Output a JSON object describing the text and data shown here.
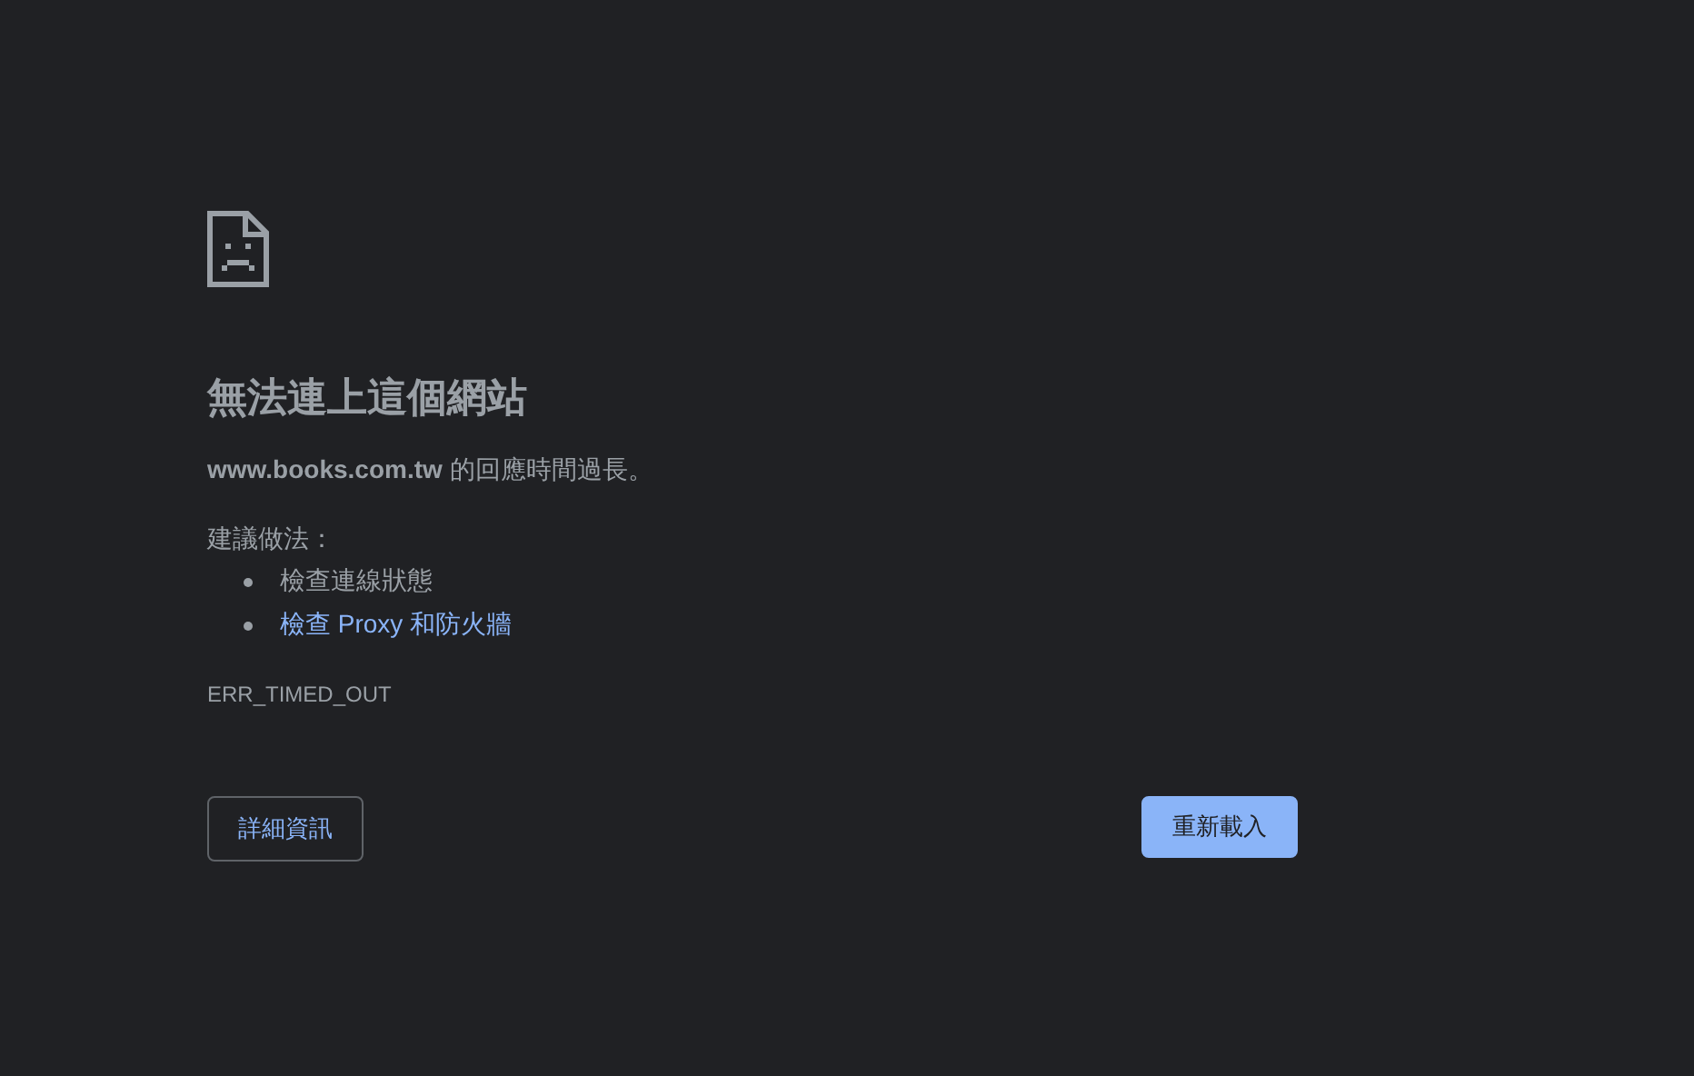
{
  "heading": "無法連上這個網站",
  "summary": "**www.books.com.tw** 的回應時間過長。",
  "suggestions_label": "建議做法：",
  "suggestions": [
    {
      "kind": "text",
      "text": "檢查連線狀態"
    },
    {
      "kind": "link",
      "text": "檢查 Proxy 和防火牆"
    }
  ],
  "error_code": "ERR_TIMED_OUT",
  "buttons": [
    {
      "kind": "outline",
      "label": "詳細資訊"
    },
    {
      "kind": "primary",
      "label": "重新載入"
    }
  ]
}
